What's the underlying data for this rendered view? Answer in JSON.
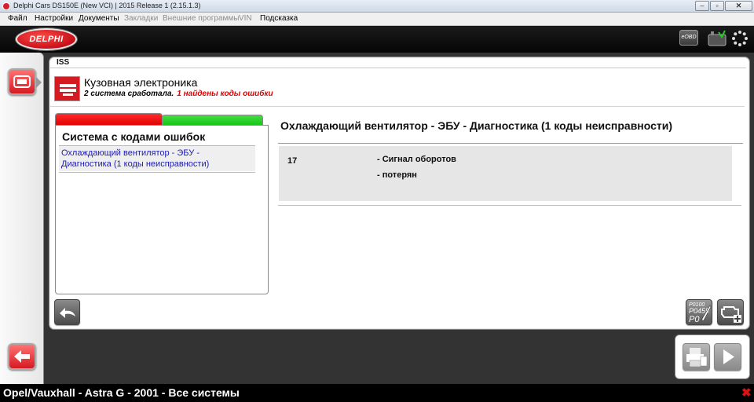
{
  "window": {
    "title": "Delphi Cars DS150E (New VCI) | 2015 Release 1 (2.15.1.3)",
    "min_glyph": "–",
    "max_glyph": "▫",
    "close_glyph": "✕"
  },
  "menu": {
    "items": [
      {
        "label": "Файл",
        "enabled": true
      },
      {
        "label": "Настройки",
        "enabled": true
      },
      {
        "label": "Документы",
        "enabled": true
      },
      {
        "label": "Закладки",
        "enabled": false
      },
      {
        "label": "Внешние программы",
        "enabled": false
      },
      {
        "label": "VIN",
        "enabled": false
      },
      {
        "label": "Подсказка",
        "enabled": true
      }
    ]
  },
  "header": {
    "logo_text": "DELPHI",
    "eobd_label": "eOBD"
  },
  "tab": {
    "label": "ISS"
  },
  "system": {
    "title": "Кузовная электроника",
    "status_ok": "2 система сработала.",
    "status_err": "1 найдены коды ошибки"
  },
  "fault_list": {
    "title": "Система с кодами ошибок",
    "item_line1": "Охлаждающий вентилятор - ЭБУ -",
    "item_line2": "Диагностика (1 коды неисправности)"
  },
  "detail": {
    "title": "Охлаждающий вентилятор - ЭБУ - Диагностика (1 коды неисправности)",
    "code": "17",
    "desc_line1": "- Сигнал оборотов",
    "desc_line2": "- потерян"
  },
  "buttons": {
    "pcode_line1": "P0100",
    "pcode_line2": "P0455",
    "pcode_line3": "P0"
  },
  "statusbar": {
    "vehicle": "Opel/Vauxhall - Astra G - 2001 - Все системы",
    "exit_glyph": "✖"
  },
  "colors": {
    "accent_red": "#d61a22",
    "error_text": "#e00000",
    "link_blue": "#1a1ab5",
    "tab_green": "#13c513"
  }
}
